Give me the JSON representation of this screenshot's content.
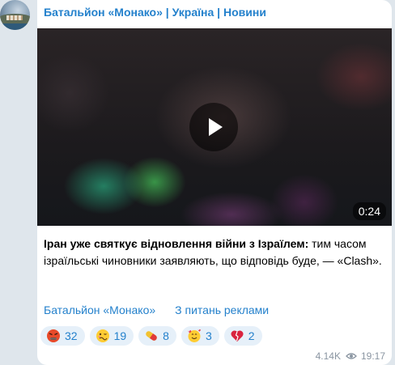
{
  "channel": {
    "name": "Батальйон «Монако» | Україна | Новини",
    "accent_color": "#2481cc"
  },
  "video": {
    "duration": "0:24",
    "play_icon": "play-icon"
  },
  "post": {
    "bold_text": "Іран уже святкує відновлення війни з Ізраїлем:",
    "text": " тим часом ізраїльські чиновники заявляють, що відповідь буде, — «Clash»."
  },
  "links": {
    "channel_link": "Батальйон «Монако»",
    "ads_link": "З питань реклами"
  },
  "reactions": [
    {
      "icon": "angry-face-icon",
      "count": "32"
    },
    {
      "icon": "woozy-face-icon",
      "count": "19"
    },
    {
      "icon": "pill-icon",
      "count": "8"
    },
    {
      "icon": "smiling-face-with-hearts-icon",
      "count": "3"
    },
    {
      "icon": "broken-heart-icon",
      "count": "2"
    }
  ],
  "meta": {
    "views": "4.14K",
    "views_icon": "eye-icon",
    "time": "19:17"
  }
}
